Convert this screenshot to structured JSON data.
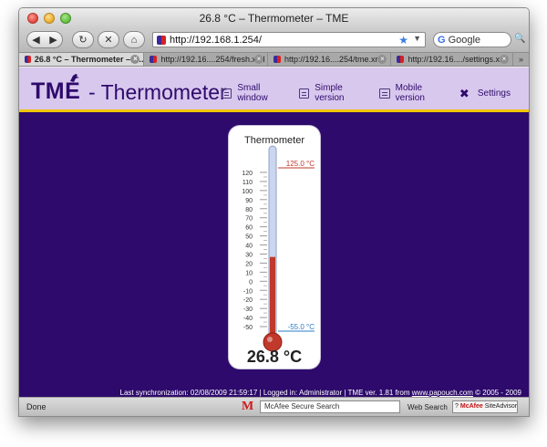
{
  "window": {
    "title": "26.8 °C – Thermometer – TME"
  },
  "toolbar": {
    "back_icon": "◀",
    "forward_icon": "▶",
    "reload_icon": "↻",
    "stop_icon": "✕",
    "home_icon": "⌂",
    "url": "http://192.168.1.254/",
    "star_icon": "★",
    "search_placeholder": "Google",
    "search_engine_icon": "G"
  },
  "tabs": [
    {
      "label": "26.8 °C – Thermometer – T...",
      "active": true
    },
    {
      "label": "http://192.16....254/fresh.xml",
      "active": false
    },
    {
      "label": "http://192.16....254/tme.xml",
      "active": false
    },
    {
      "label": "http://192.16..../settings.xml",
      "active": false
    }
  ],
  "tab_overflow": "»",
  "app": {
    "logo": "TME",
    "title": "- Thermometer",
    "nav": [
      {
        "label": "Small window",
        "icon": "window-icon"
      },
      {
        "label": "Simple version",
        "icon": "window-icon"
      },
      {
        "label": "Mobile version",
        "icon": "window-icon"
      },
      {
        "label": "Settings",
        "icon": "tools-icon"
      }
    ]
  },
  "thermometer": {
    "heading": "Thermometer",
    "current_value": 26.8,
    "current_display": "26.8 °C",
    "max_label": "125.0 °C",
    "min_label": "-55.0 °C",
    "scale_min": -55,
    "scale_max": 125,
    "tick_labels": [
      "120",
      "110",
      "100",
      "90",
      "80",
      "70",
      "60",
      "50",
      "40",
      "30",
      "20",
      "10",
      "0",
      "-10",
      "-20",
      "-30",
      "-40",
      "-50"
    ],
    "colors": {
      "mercury": "#c0392b",
      "tube": "#c9d6ee",
      "max_line": "#c0392b",
      "min_line": "#2a7bc8"
    }
  },
  "footer": {
    "sync": "Last synchronization: 02/08/2009 21:59:17",
    "logged_in": "Logged in: Administrator",
    "version": "TME ver. 1.81 from",
    "link": "www.papouch.com",
    "copyright": "© 2005 - 2009"
  },
  "statusbar": {
    "status": "Done",
    "mcafee_logo": "M",
    "mcafee_search": "McAfee Secure Search",
    "web_search": "Web Search",
    "siteadvisor_prefix": "McAfee",
    "siteadvisor": "SiteAdvisor"
  },
  "brand_colors": {
    "page_bg": "#2d0a6b",
    "header_bg": "#d9c8ee",
    "header_underline": "#f0c400"
  }
}
